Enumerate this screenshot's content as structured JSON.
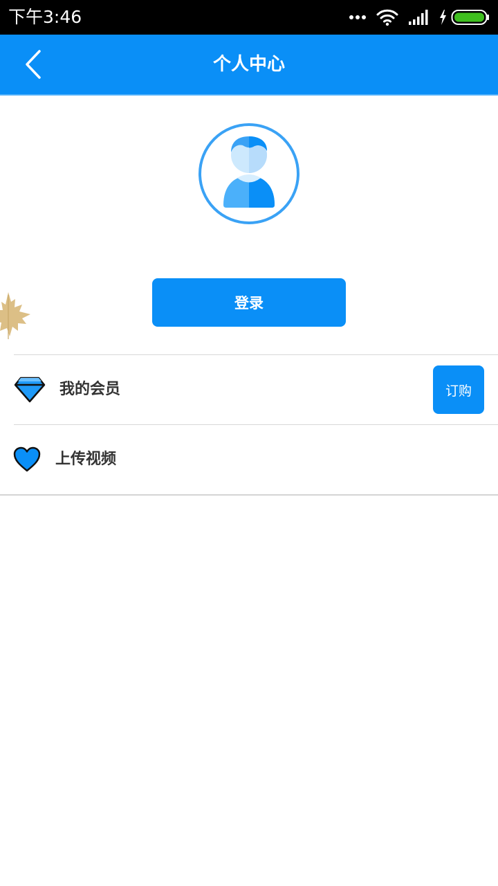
{
  "status_bar": {
    "time": "下午3:46",
    "icons": [
      "more-dots-icon",
      "wifi-icon",
      "signal-icon",
      "charging-bolt-icon",
      "battery-icon"
    ],
    "battery_color": "#3fbf1f"
  },
  "header": {
    "title": "个人中心",
    "back_icon": "chevron-left-icon",
    "background": "#0a8ff7"
  },
  "profile": {
    "avatar_icon": "user-avatar-icon",
    "login_label": "登录"
  },
  "menu": {
    "items": [
      {
        "icon": "diamond-icon",
        "label": "我的会员",
        "action_label": "订购"
      },
      {
        "icon": "heart-icon",
        "label": "上传视频"
      }
    ]
  },
  "colors": {
    "accent": "#0a8ff7",
    "text": "#333333",
    "divider": "#d7d7d7"
  }
}
